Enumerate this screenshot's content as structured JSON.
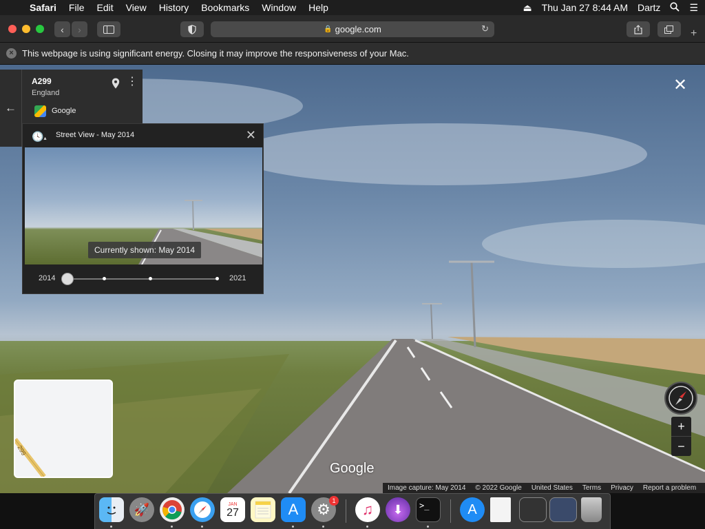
{
  "menubar": {
    "app": "Safari",
    "items": [
      "File",
      "Edit",
      "View",
      "History",
      "Bookmarks",
      "Window",
      "Help"
    ],
    "clock": "Thu Jan 27  8:44 AM",
    "user": "Dartz"
  },
  "browser": {
    "url": "google.com"
  },
  "energy_banner": {
    "text": "This webpage is using significant energy. Closing it may improve the responsiveness of your Mac."
  },
  "place": {
    "road": "A299",
    "region": "England",
    "provider": "Google"
  },
  "timeline": {
    "title": "Street View - May 2014",
    "tooltip": "Currently shown: May 2014",
    "start_year": "2014",
    "end_year": "2021"
  },
  "minimap": {
    "road_label": "299"
  },
  "logo": "Google",
  "footer": {
    "capture": "Image capture: May 2014",
    "copyright": "© 2022 Google",
    "country": "United States",
    "terms": "Terms",
    "privacy": "Privacy",
    "report": "Report a problem"
  },
  "dock": {
    "calendar_month": "JAN",
    "calendar_day": "27",
    "settings_badge": "1"
  }
}
